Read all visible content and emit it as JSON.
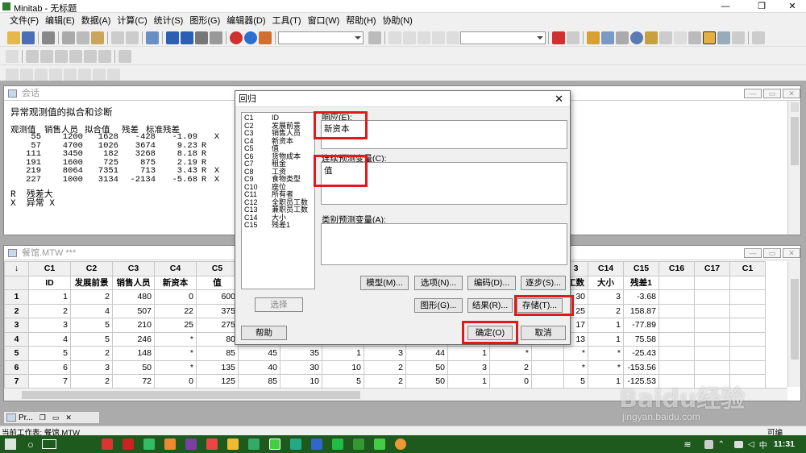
{
  "window": {
    "title": "Minitab - 无标题"
  },
  "menu": [
    "文件(F)",
    "编辑(E)",
    "数据(A)",
    "计算(C)",
    "统计(S)",
    "图形(G)",
    "编辑器(D)",
    "工具(T)",
    "窗口(W)",
    "帮助(H)",
    "协助(N)"
  ],
  "session": {
    "title": "会话",
    "heading": "异常观测值的拟合和诊断",
    "table_header": [
      "观测值",
      "销售人员",
      "拟合值",
      "残差",
      "标准残差"
    ],
    "rows": [
      [
        "55",
        "1200",
        "1628",
        "-428",
        "-1.09",
        "",
        "X"
      ],
      [
        "57",
        "4700",
        "1026",
        "3674",
        "9.23",
        "R",
        ""
      ],
      [
        "111",
        "3450",
        "182",
        "3268",
        "8.18",
        "R",
        ""
      ],
      [
        "191",
        "1600",
        "725",
        "875",
        "2.19",
        "R",
        ""
      ],
      [
        "219",
        "8064",
        "7351",
        "713",
        "3.43",
        "R",
        "X"
      ],
      [
        "227",
        "1000",
        "3134",
        "-2134",
        "-5.68",
        "R",
        "X"
      ]
    ],
    "footnote_r": "R  残差大",
    "footnote_x": "X  异常 X"
  },
  "worksheet": {
    "title": "餐馆.MTW ***",
    "corner": "↓",
    "left_cols": [
      "C1",
      "C2",
      "C3",
      "C4",
      "C5"
    ],
    "left_names": [
      "ID",
      "发展前景",
      "销售人员",
      "新资本",
      "值"
    ],
    "right_cols": [
      "C14",
      "C15",
      "C16",
      "C17",
      "C1"
    ],
    "right_names": [
      "大小",
      "残差1",
      "",
      "",
      ""
    ],
    "partial_col": "3",
    "partial_name": "工数",
    "rows": [
      {
        "n": "1",
        "left": [
          "1",
          "2",
          "480",
          "0",
          "600"
        ],
        "mid": [],
        "p": "30",
        "right": [
          "3",
          "-3.68"
        ]
      },
      {
        "n": "2",
        "left": [
          "2",
          "4",
          "507",
          "22",
          "375"
        ],
        "mid": [],
        "p": "25",
        "right": [
          "2",
          "158.87"
        ]
      },
      {
        "n": "3",
        "left": [
          "3",
          "5",
          "210",
          "25",
          "275"
        ],
        "mid": [],
        "p": "17",
        "right": [
          "1",
          "-77.89"
        ]
      },
      {
        "n": "4",
        "left": [
          "4",
          "5",
          "246",
          "*",
          "80"
        ],
        "mid": [],
        "p": "13",
        "right": [
          "1",
          "75.58"
        ]
      },
      {
        "n": "5",
        "left": [
          "5",
          "2",
          "148",
          "*",
          "85"
        ],
        "mid": [
          "45",
          "35",
          "1",
          "3",
          "44",
          "1",
          "*"
        ],
        "p": "*",
        "right": [
          "*",
          "-25.43"
        ]
      },
      {
        "n": "6",
        "left": [
          "6",
          "3",
          "50",
          "*",
          "135"
        ],
        "mid": [
          "40",
          "30",
          "10",
          "2",
          "50",
          "3",
          "2"
        ],
        "p": "*",
        "right": [
          "*",
          "-153.56"
        ]
      },
      {
        "n": "7",
        "left": [
          "7",
          "2",
          "72",
          "0",
          "125"
        ],
        "mid": [
          "85",
          "10",
          "5",
          "2",
          "50",
          "1",
          "0"
        ],
        "p": "5",
        "right": [
          "1",
          "-125.53"
        ]
      }
    ]
  },
  "dialog": {
    "title": "回归",
    "variables": [
      [
        "C1",
        "ID"
      ],
      [
        "C2",
        "发展前景"
      ],
      [
        "C3",
        "销售人员"
      ],
      [
        "C4",
        "新资本"
      ],
      [
        "C5",
        "值"
      ],
      [
        "C6",
        "货物成本"
      ],
      [
        "C7",
        "租金"
      ],
      [
        "C8",
        "工资"
      ],
      [
        "C9",
        "食物类型"
      ],
      [
        "C10",
        "座位"
      ],
      [
        "C11",
        "所有者"
      ],
      [
        "C12",
        "全职员工数"
      ],
      [
        "C13",
        "兼职员工数"
      ],
      [
        "C14",
        "大小"
      ],
      [
        "C15",
        "残差1"
      ]
    ],
    "response_label": "响应(E):",
    "response_value": "新资本",
    "continuous_label": "连续预测变量(C):",
    "continuous_value": "值",
    "categorical_label": "类别预测变量(A):",
    "select_btn": "选择",
    "help_btn": "帮助",
    "model_btn": "模型(M)...",
    "options_btn": "选项(N)...",
    "coding_btn": "编码(D)...",
    "stepwise_btn": "逐步(S)...",
    "graphs_btn": "图形(G)...",
    "results_btn": "结果(R)...",
    "storage_btn": "存储(T)...",
    "ok_btn": "确定(O)",
    "cancel_btn": "取消"
  },
  "statusbar": {
    "text": "当前工作表: 餐馆.MTW",
    "right": "可编"
  },
  "tabstrip": {
    "label": "Pr..."
  },
  "taskbar": {
    "time": "11:31"
  },
  "watermark": {
    "brand": "Baidu经验",
    "url": "jingyan.baidu.com"
  },
  "colors": {
    "highlight": "#e0191b",
    "taskbar": "#1e5a1e"
  }
}
